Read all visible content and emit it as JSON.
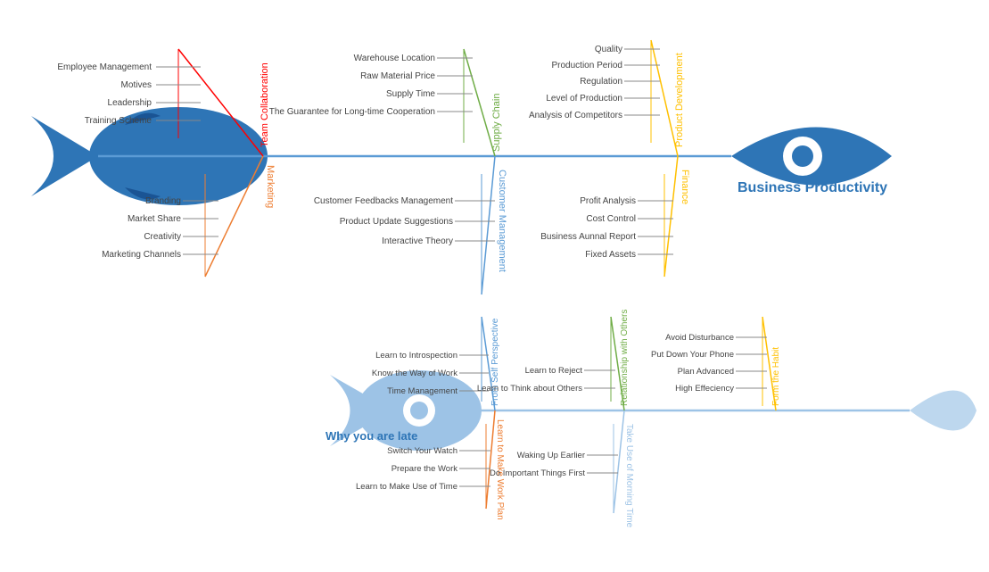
{
  "diagram1": {
    "title": "Business Productivity",
    "fish_color": "#2e75b6",
    "bones": {
      "top_left": {
        "label": "Team Collaboration",
        "items": [
          "Employee Management",
          "Motives",
          "Leadership",
          "Training Scheme"
        ]
      },
      "top_mid": {
        "label": "Supply Chain",
        "items": [
          "Warehouse Location",
          "Raw Material Price",
          "Supply Time",
          "The Guarantee for Long-time Cooperation"
        ]
      },
      "top_right": {
        "label": "Product Development",
        "items": [
          "Quality",
          "Production Period",
          "Regulation",
          "Level of Production",
          "Analysis of Competitors"
        ]
      },
      "bot_left": {
        "label": "Marketing",
        "items": [
          "Branding",
          "Market Share",
          "Creativity",
          "Marketing Channels"
        ]
      },
      "bot_mid": {
        "label": "Customer Management",
        "items": [
          "Customer Feedbacks Management",
          "Product Update Suggestions",
          "Interactive Theory"
        ]
      },
      "bot_right": {
        "label": "Finance",
        "items": [
          "Profit Analysis",
          "Cost Control",
          "Business Aunnal Report",
          "Fixed Assets"
        ]
      }
    }
  },
  "diagram2": {
    "title": "Why you are late",
    "fish_color": "#9dc3e6",
    "bones": {
      "top_left": {
        "label": "From Self Perspective",
        "items": [
          "Learn to Introspection",
          "Know the Way of Work",
          "Time Management"
        ]
      },
      "top_right": {
        "label": "Relationship with Others",
        "items": [
          "Learn to Reject",
          "Learn to Think about Others"
        ]
      },
      "top_far_right": {
        "label": "Form the Habit",
        "items": [
          "Avoid Disturbance",
          "Put Down Your Phone",
          "Plan Advanced",
          "High Effeciency"
        ]
      },
      "bot_left": {
        "label": "Learn to Make Work Plan",
        "items": [
          "Switch Your Watch",
          "Prepare the Work",
          "Learn to Make Use of Time"
        ]
      },
      "bot_right": {
        "label": "Take Use of Morning Time",
        "items": [
          "Waking Up Earlier",
          "Do Important Things First"
        ]
      }
    }
  }
}
